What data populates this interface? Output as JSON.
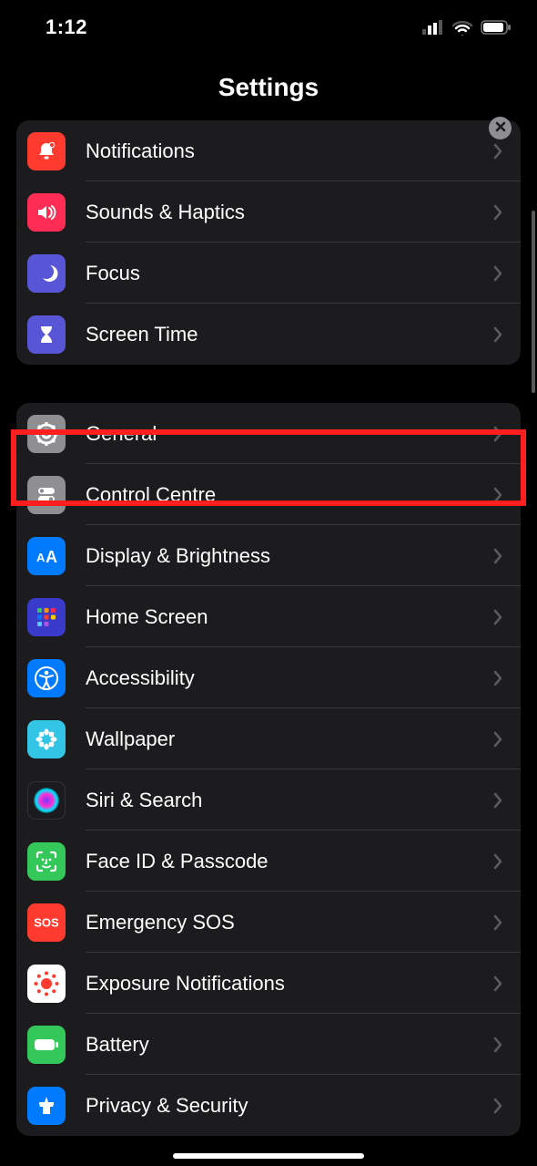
{
  "status": {
    "time": "1:12"
  },
  "header": {
    "title": "Settings"
  },
  "groups": [
    {
      "rows": [
        {
          "key": "notifications",
          "label": "Notifications"
        },
        {
          "key": "sounds",
          "label": "Sounds & Haptics"
        },
        {
          "key": "focus",
          "label": "Focus"
        },
        {
          "key": "screentime",
          "label": "Screen Time"
        }
      ]
    },
    {
      "rows": [
        {
          "key": "general",
          "label": "General"
        },
        {
          "key": "controlcentre",
          "label": "Control Centre"
        },
        {
          "key": "display",
          "label": "Display & Brightness"
        },
        {
          "key": "homescreen",
          "label": "Home Screen"
        },
        {
          "key": "accessibility",
          "label": "Accessibility"
        },
        {
          "key": "wallpaper",
          "label": "Wallpaper"
        },
        {
          "key": "siri",
          "label": "Siri & Search"
        },
        {
          "key": "faceid",
          "label": "Face ID & Passcode"
        },
        {
          "key": "sos",
          "label": "Emergency SOS"
        },
        {
          "key": "exposure",
          "label": "Exposure Notifications"
        },
        {
          "key": "battery",
          "label": "Battery"
        },
        {
          "key": "privacy",
          "label": "Privacy & Security"
        }
      ]
    }
  ],
  "highlight": {
    "row_key": "general"
  }
}
